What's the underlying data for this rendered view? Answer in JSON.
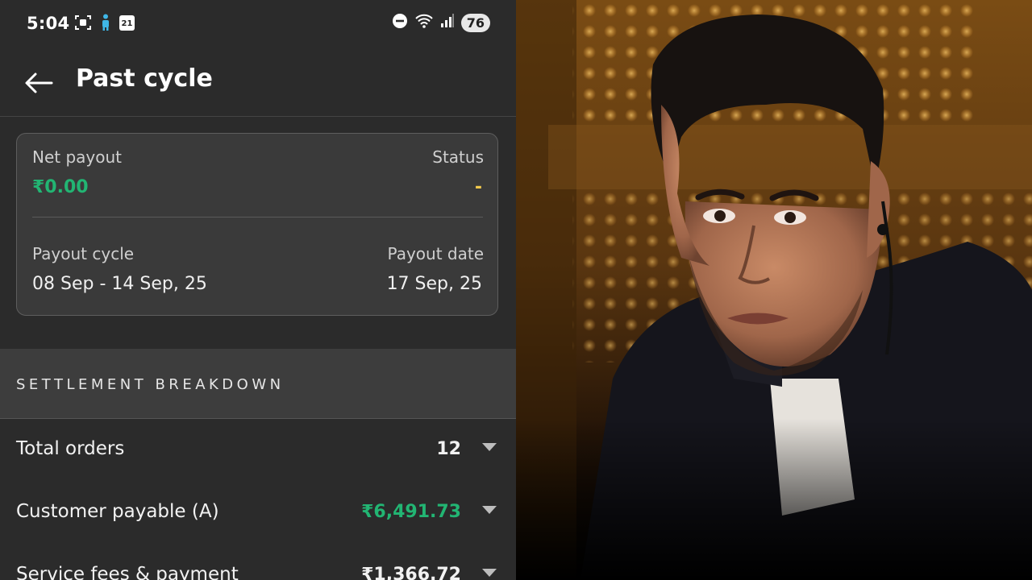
{
  "status_bar": {
    "time": "5:04",
    "calendar_day": "21",
    "battery": "76"
  },
  "header": {
    "title": "Past cycle"
  },
  "summary_card": {
    "net_payout_label": "Net payout",
    "net_payout_value": "₹0.00",
    "status_label": "Status",
    "status_value": "-",
    "payout_cycle_label": "Payout cycle",
    "payout_cycle_value": "08 Sep - 14 Sep, 25",
    "payout_date_label": "Payout date",
    "payout_date_value": "17 Sep, 25"
  },
  "settlement": {
    "heading": "SETTLEMENT BREAKDOWN",
    "rows": [
      {
        "label": "Total orders",
        "value": "12"
      },
      {
        "label": "Customer payable (A)",
        "value": "₹6,491.73"
      },
      {
        "label": "Service fees & payment",
        "value": "₹1,366.72"
      }
    ]
  },
  "colors": {
    "accent_green": "#22b573",
    "status_yellow": "#f2c94c",
    "background": "#2b2b2b"
  }
}
